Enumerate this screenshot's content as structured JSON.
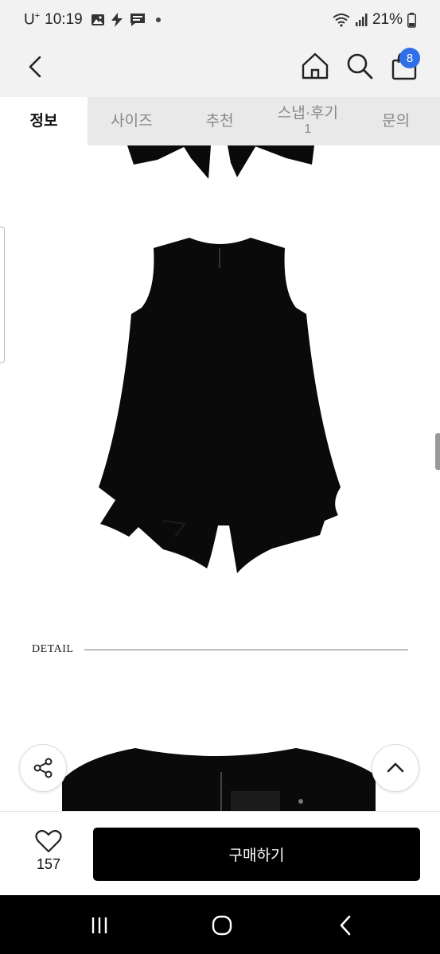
{
  "status": {
    "carrier": "U",
    "carrier_sup": "+",
    "time": "10:19",
    "battery": "21%",
    "icons": [
      "gallery-icon",
      "bolt-icon",
      "webtoon-icon",
      "dot-icon",
      "wifi-icon",
      "signal-icon",
      "battery-icon"
    ]
  },
  "header": {
    "icons": [
      "back-icon",
      "home-icon",
      "search-icon",
      "shopping-bag-icon"
    ],
    "cart_count": "8"
  },
  "tabs": [
    {
      "label": "정보",
      "active": true
    },
    {
      "label": "사이즈",
      "active": false
    },
    {
      "label": "추천",
      "active": false
    },
    {
      "label": "스냅·후기",
      "sub": "1",
      "active": false
    },
    {
      "label": "문의",
      "active": false
    }
  ],
  "content": {
    "detail_label": "DETAIL",
    "garment_color": "#0a0a0a"
  },
  "fabs": {
    "share_icon": "share-icon",
    "top_icon": "chevron-up-icon"
  },
  "bottom": {
    "wish_icon": "heart-icon",
    "wish_count": "157",
    "buy_label": "구매하기"
  },
  "navbar": {
    "icons": [
      "recent-apps-icon",
      "home-circle-icon",
      "back-nav-icon"
    ]
  },
  "colors": {
    "accent": "#2f6fe8",
    "buy_button": "#000000",
    "tab_bar": "#e9e9e9"
  }
}
